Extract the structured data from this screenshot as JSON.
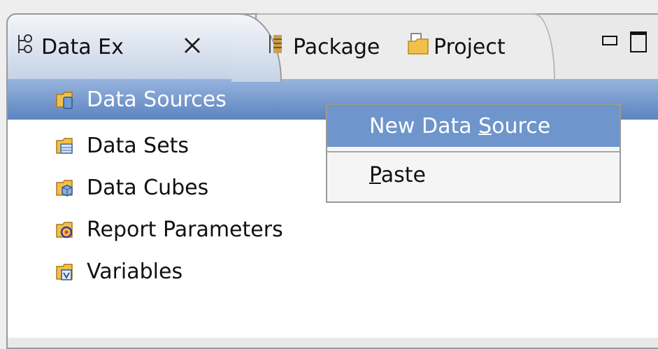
{
  "tabs": [
    {
      "label": "Data Ex",
      "icon": "data-explorer-icon",
      "active": true,
      "closable": true
    },
    {
      "label": "Package",
      "icon": "package-icon",
      "active": false
    },
    {
      "label": "Project",
      "icon": "project-folder-icon",
      "active": false
    }
  ],
  "tree": {
    "items": [
      {
        "label": "Data Sources",
        "icon": "data-sources-folder-icon",
        "selected": true
      },
      {
        "label": "Data Sets",
        "icon": "data-sets-folder-icon"
      },
      {
        "label": "Data Cubes",
        "icon": "data-cubes-folder-icon"
      },
      {
        "label": "Report Parameters",
        "icon": "report-parameters-folder-icon"
      },
      {
        "label": "Variables",
        "icon": "variables-folder-icon"
      }
    ]
  },
  "context_menu": {
    "items": [
      {
        "label_pre": "New Data ",
        "mnemonic": "S",
        "label_post": "ource",
        "highlighted": true
      },
      {
        "label_pre": "",
        "mnemonic": "P",
        "label_post": "aste",
        "highlighted": false
      }
    ]
  },
  "colors": {
    "selection": "#5c84c0",
    "menu_highlight": "#6e95cc",
    "folder": "#f0b840"
  }
}
